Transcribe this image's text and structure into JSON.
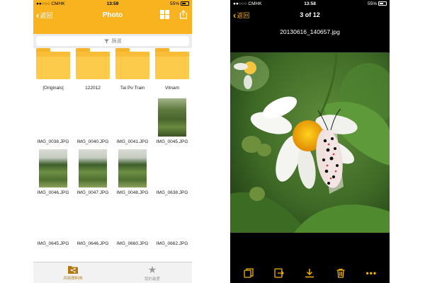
{
  "left_screen": {
    "status": {
      "carrier": "●●○○○ CMHK",
      "time": "13:59",
      "battery": "55%"
    },
    "nav": {
      "back_label": "返回",
      "title": "Photo"
    },
    "filter": {
      "placeholder": "篩選"
    },
    "folders": [
      {
        "name": "[Originals]"
      },
      {
        "name": "122012"
      },
      {
        "name": "Tai Po Train"
      },
      {
        "name": "Vitnam"
      }
    ],
    "files": [
      {
        "name": "IMG_0038.JPG",
        "thumbnail": "none"
      },
      {
        "name": "IMG_0040.JPG",
        "thumbnail": "none"
      },
      {
        "name": "IMG_0041.JPG",
        "thumbnail": "none"
      },
      {
        "name": "IMG_0045.JPG",
        "thumbnail": "forest"
      },
      {
        "name": "IMG_0046.JPG",
        "thumbnail": "garden"
      },
      {
        "name": "IMG_0047.JPG",
        "thumbnail": "garden"
      },
      {
        "name": "IMG_0048.JPG",
        "thumbnail": "garden"
      },
      {
        "name": "IMG_0638.JPG",
        "thumbnail": "none"
      },
      {
        "name": "IMG_0645.JPG",
        "thumbnail": "none"
      },
      {
        "name": "IMG_0646.JPG",
        "thumbnail": "none"
      },
      {
        "name": "IMG_0660.JPG",
        "thumbnail": "none"
      },
      {
        "name": "IMG_0662.JPG",
        "thumbnail": "none"
      }
    ],
    "tabs": [
      {
        "label": "共用資料夾",
        "icon": "shared-folder-icon",
        "active": true
      },
      {
        "label": "我的最愛",
        "icon": "star-icon",
        "active": false
      }
    ],
    "colors": {
      "accent": "#f8b31f",
      "folder": "#fccb4b"
    }
  },
  "right_screen": {
    "status": {
      "carrier": "●●○○○ CMHK",
      "time": "13:58",
      "battery": "55%"
    },
    "nav": {
      "back_label": "返回",
      "title": "3 of 12"
    },
    "filename": "20130616_140657.jpg",
    "toolbar": [
      {
        "icon": "copy-icon"
      },
      {
        "icon": "move-icon"
      },
      {
        "icon": "download-icon"
      },
      {
        "icon": "trash-icon"
      },
      {
        "icon": "more-icon",
        "label": "•••"
      }
    ],
    "colors": {
      "background": "#000000",
      "accent": "#f5b300"
    }
  }
}
